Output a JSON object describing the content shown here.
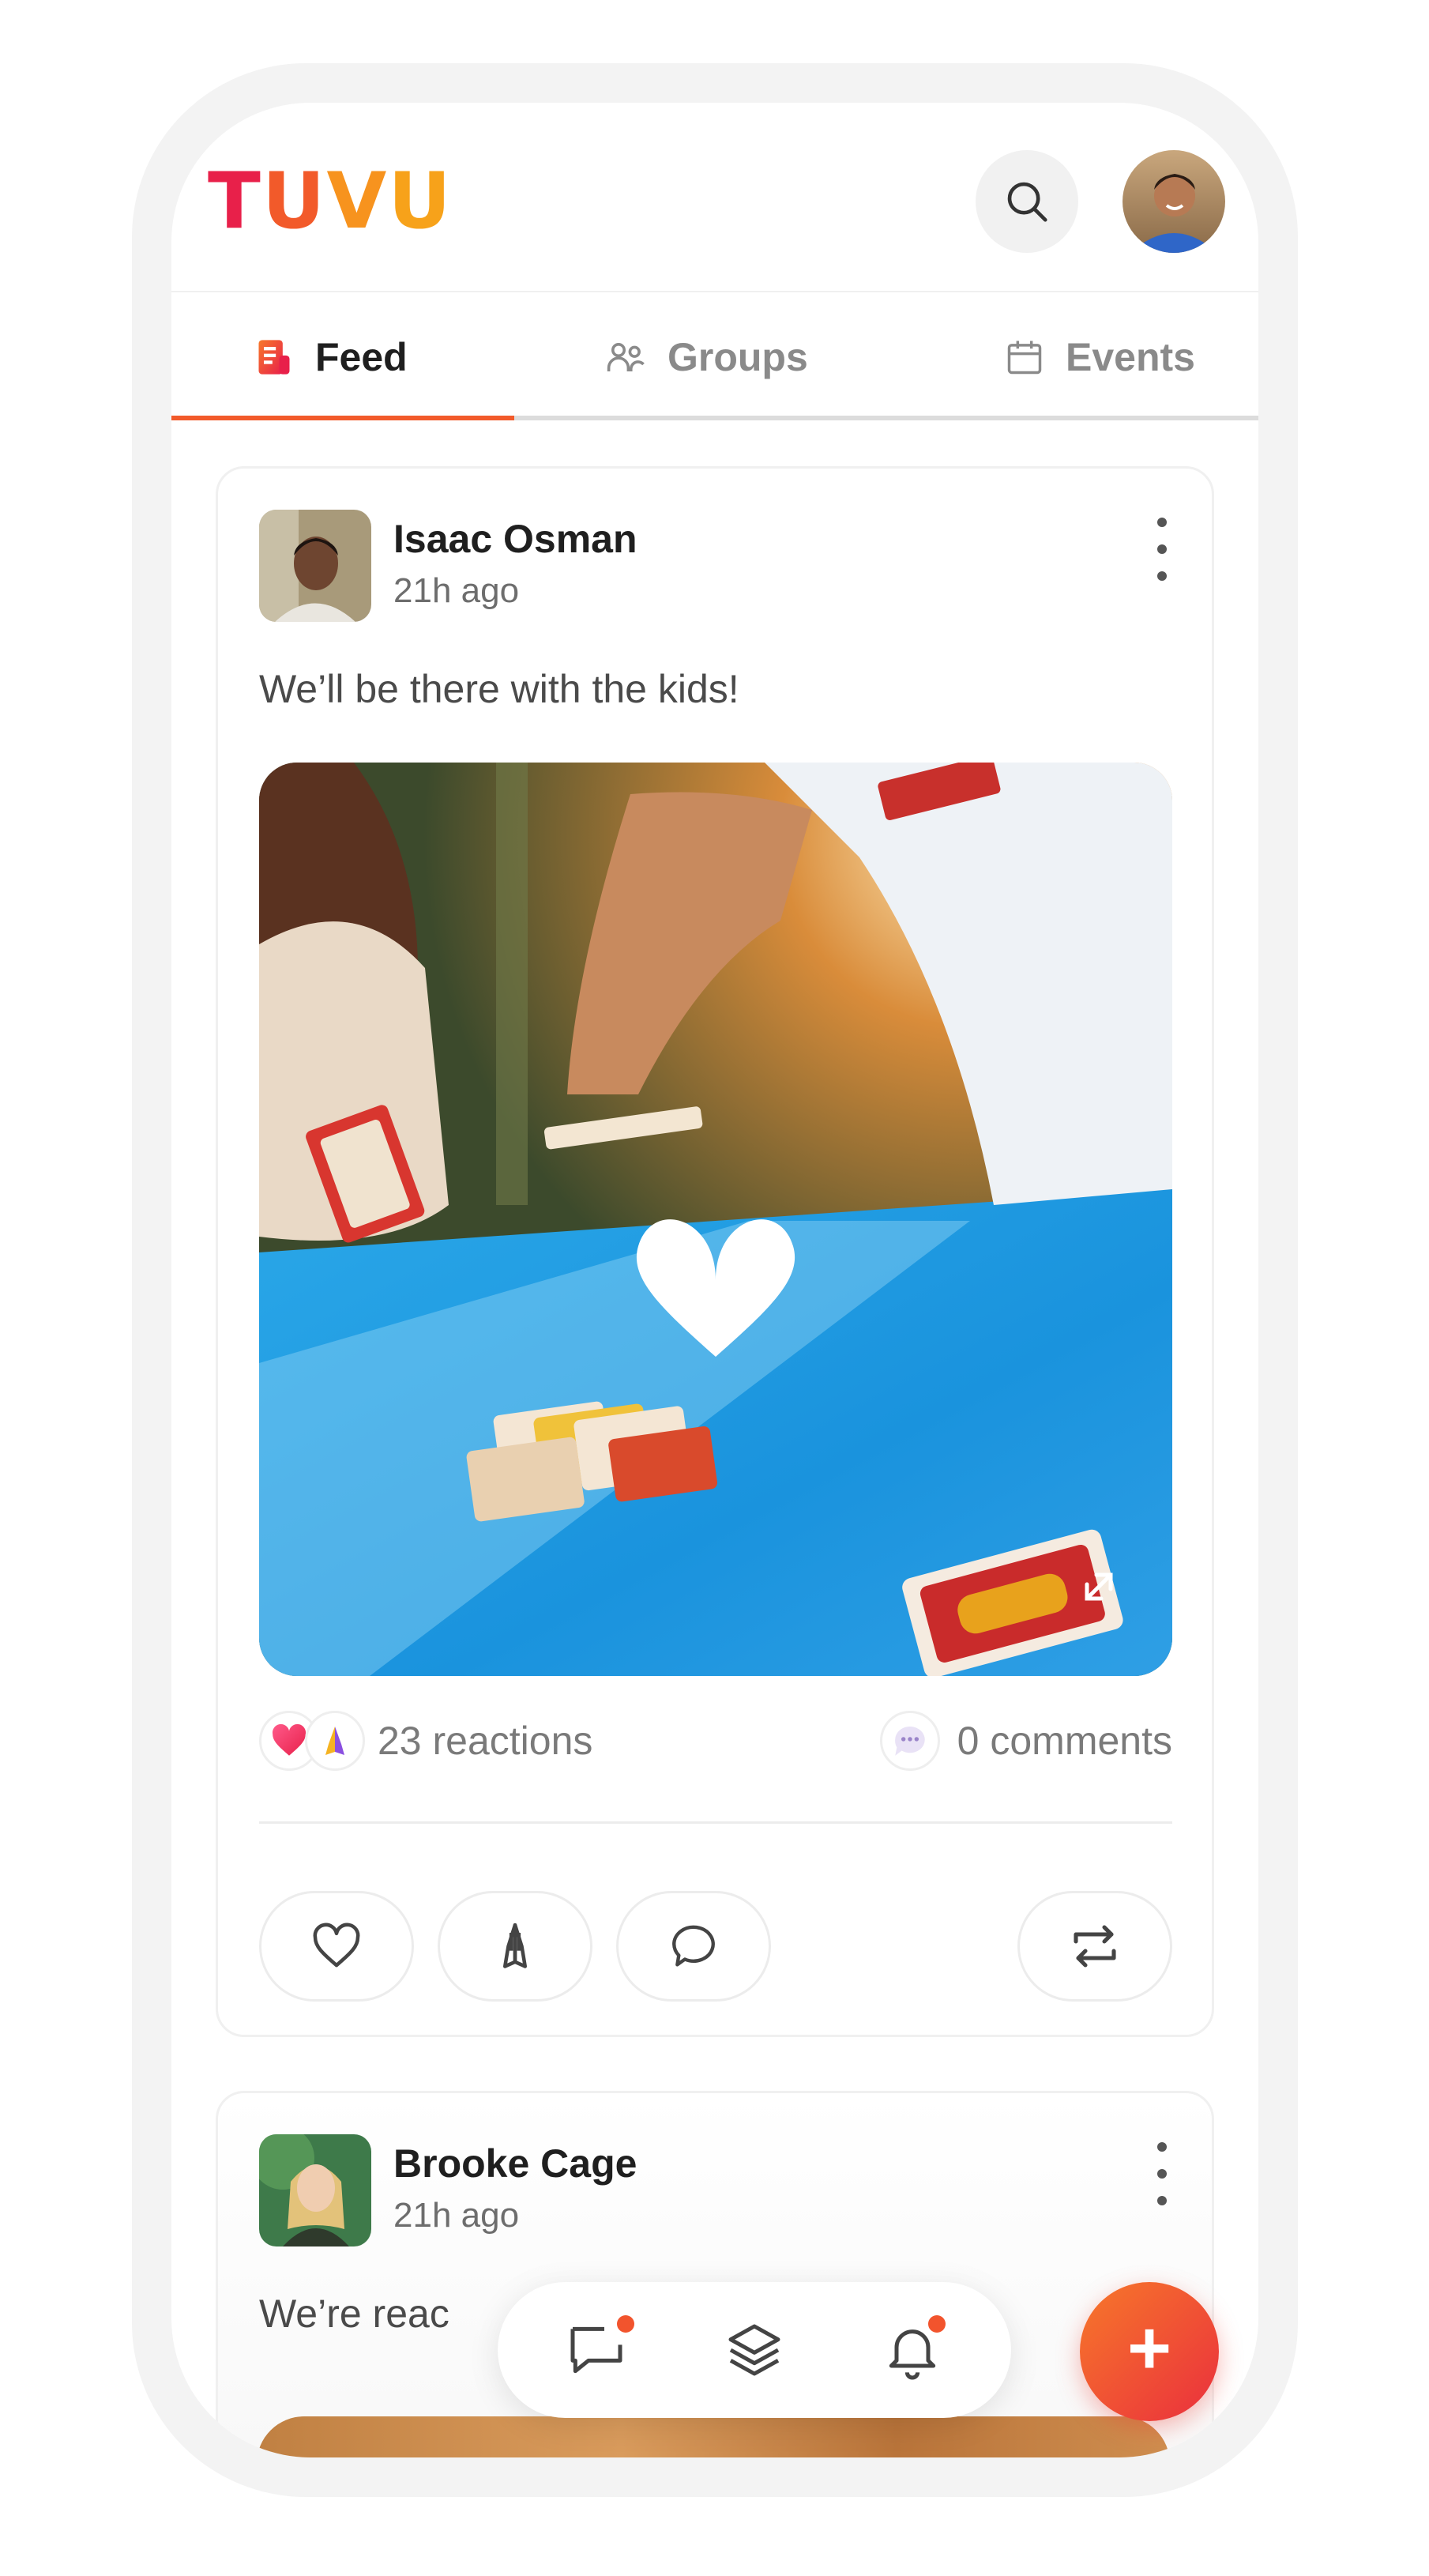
{
  "app": {
    "logo_text": "TUVU",
    "colors": {
      "accent": "#f25a2a",
      "logo_red": "#e8204a",
      "logo_orange": "#f7931e"
    }
  },
  "header": {
    "search_icon": "search-icon",
    "profile_avatar": "user-avatar"
  },
  "tabs": [
    {
      "label": "Feed",
      "icon": "feed-icon",
      "active": true
    },
    {
      "label": "Groups",
      "icon": "groups-icon",
      "active": false
    },
    {
      "label": "Events",
      "icon": "calendar-icon",
      "active": false
    }
  ],
  "posts": [
    {
      "author": "Isaac Osman",
      "time": "21h ago",
      "text": "We’ll be there with the kids!",
      "reactions": "23 reactions",
      "comments": "0 comments",
      "actions": [
        "heart-icon",
        "pray-icon",
        "comment-icon",
        "repost-icon"
      ]
    },
    {
      "author": "Brooke Cage",
      "time": "21h ago",
      "text": "We’re reac"
    }
  ],
  "bottom_nav": {
    "items": [
      "chat-icon",
      "layers-icon",
      "bell-icon"
    ],
    "fab_label": "+"
  }
}
